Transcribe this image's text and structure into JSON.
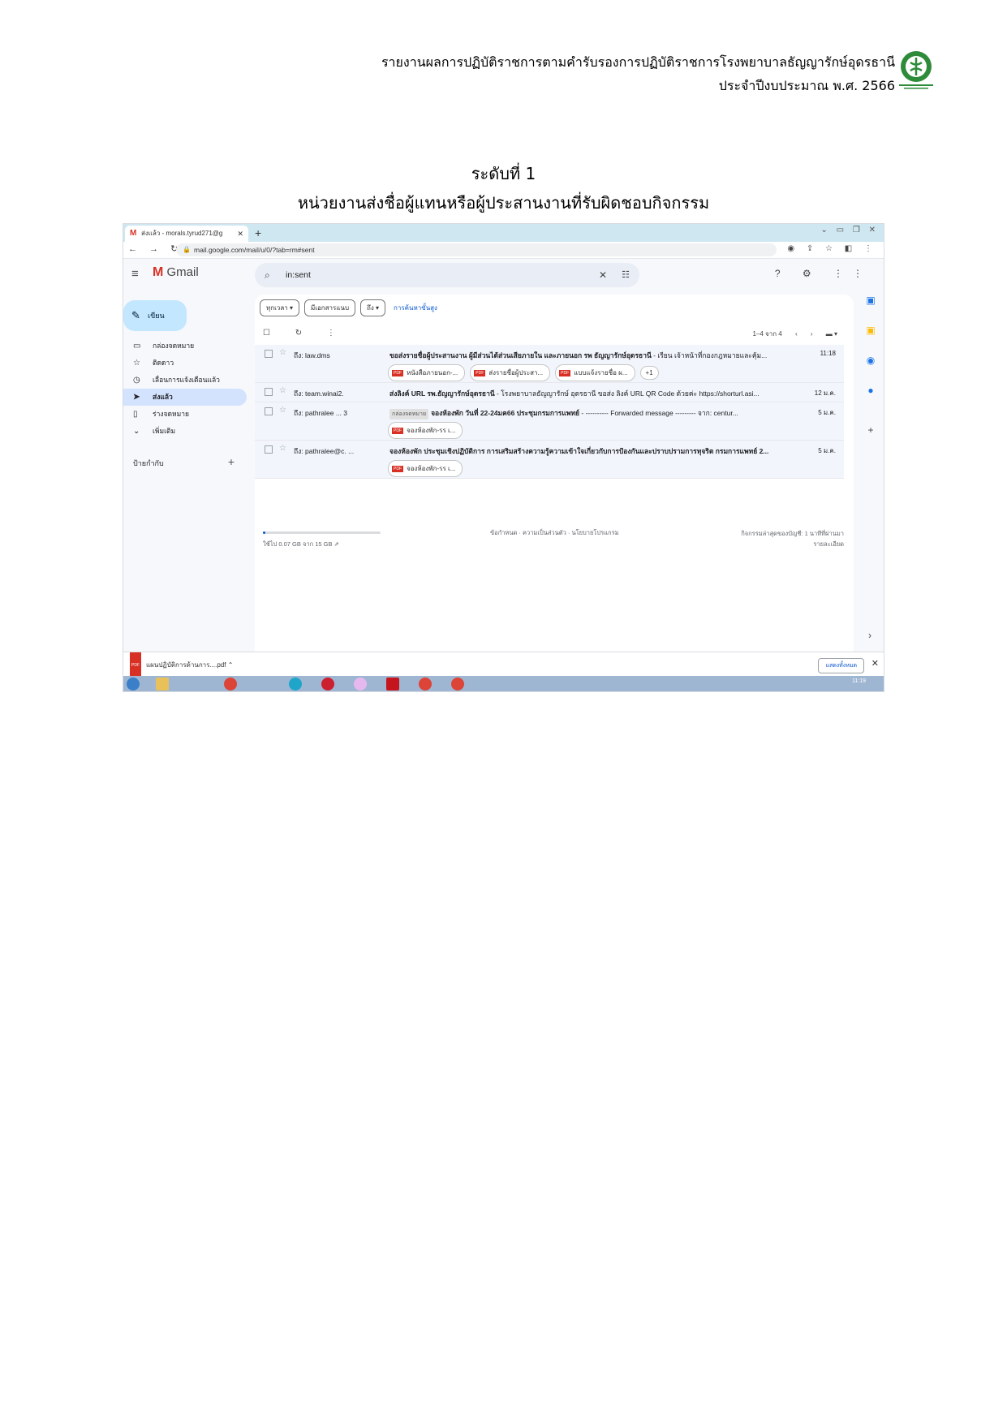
{
  "doc_header": {
    "line1": "รายงานผลการปฏิบัติราชการตามคำรับรองการปฏิบัติราชการโรงพยาบาลธัญญารักษ์อุดรธานี",
    "line2": "ประจำปีงบประมาณ พ.ศ. 2566"
  },
  "section": {
    "level": "ระดับที่ 1",
    "title": "หน่วยงานส่งชื่อผู้แทนหรือผู้ประสานงานที่รับผิดชอบกิจกรรม"
  },
  "browser": {
    "tab_title": "ส่งแล้ว - morals.tyrud271@g",
    "url": "mail.google.com/mail/u/0/?tab=rm#sent"
  },
  "gmail": {
    "logo_text": "Gmail",
    "search_value": "in:sent",
    "compose_label": "เขียน",
    "nav": [
      {
        "icon": "inbox-icon",
        "glyph": "▭",
        "label": "กล่องจดหมาย"
      },
      {
        "icon": "star-icon",
        "glyph": "☆",
        "label": "ติดดาว"
      },
      {
        "icon": "clock-icon",
        "glyph": "◷",
        "label": "เลื่อนการแจ้งเตือนแล้ว"
      },
      {
        "icon": "send-icon",
        "glyph": "➤",
        "label": "ส่งแล้ว"
      },
      {
        "icon": "draft-icon",
        "glyph": "▯",
        "label": "ร่างจดหมาย"
      },
      {
        "icon": "chevron-down-icon",
        "glyph": "⌄",
        "label": "เพิ่มเติม"
      }
    ],
    "labels_heading": "ป้ายกำกับ",
    "filters": {
      "time": "ทุกเวลา ▾",
      "attachment": "มีเอกสารแนบ",
      "to": "ถึง ▾",
      "advanced": "การค้นหาขั้นสูง"
    },
    "pager": "1–4 จาก 4",
    "emails": [
      {
        "sender": "ถึง: law.dms",
        "subject": "ขอส่งรายชื่อผู้ประสานงาน ผู้มีส่วนได้ส่วนเสียภายใน และภายนอก รพ ธัญญารักษ์อุดรธานี",
        "snippet": " - เรียน เจ้าหน้าที่กองกฎหมายและคุ้ม...",
        "tag": "",
        "date": "11:18",
        "attachments": [
          "หนังสือภายนอก-...",
          "ส่งรายชื่อผู้ประสา...",
          "แบบแจ้งรายชื่อ ผ..."
        ],
        "more": "+1"
      },
      {
        "sender": "ถึง: team.winai2.",
        "subject": "ส่งลิงค์ URL รพ.ธัญญารักษ์อุดรธานี",
        "snippet": " - โรงพยาบาลธัญญารักษ์ อุดรธานี ขอส่ง ลิงค์ URL QR Code ด้วยค่ะ https://shorturl.asi...",
        "tag": "",
        "date": "12 ม.ค.",
        "attachments": [],
        "more": ""
      },
      {
        "sender": "ถึง: pathralee ... 3",
        "subject": "จองห้องพัก วันที่ 22-24มค66 ประชุมกรมการแพทย์",
        "snippet": " - ---------- Forwarded message --------- จาก: centur...",
        "tag": "กล่องจดหมาย",
        "date": "5 ม.ค.",
        "attachments": [
          "จองห้องพัก-รร เ..."
        ],
        "more": ""
      },
      {
        "sender": "ถึง: pathralee@c. ...",
        "subject": "จองห้องพัก ประชุมเชิงปฏิบัติการ การเสริมสร้างความรู้ความเข้าใจเกี่ยวกับการป้องกันและปราบปรามการทุจริต กรมการแพทย์ 2...",
        "snippet": "",
        "tag": "",
        "date": "5 ม.ค.",
        "attachments": [
          "จองห้องพัก-รร เ..."
        ],
        "more": ""
      }
    ],
    "storage_text": "ใช้ไป 0.07 GB จาก 15 GB",
    "storage_fraction": 0.005,
    "policy_text": "ข้อกำหนด · ความเป็นส่วนตัว · นโยบายโปรแกรม",
    "activity_line1": "กิจกรรมล่าสุดของบัญชี: 1 นาทีที่ผ่านมา",
    "activity_line2": "รายละเอียด"
  },
  "download_bar": {
    "file": "แผนปฏิบัติการด้านการ....pdf",
    "show_all": "แสดงทั้งหมด"
  },
  "taskbar": {
    "time": "11:19"
  },
  "colors": {
    "gmail_red": "#d93025",
    "compose_bg": "#c2e7ff",
    "active_nav": "#d3e3fd",
    "tabbar": "#cfe7f1",
    "link_blue": "#0b57d0"
  }
}
